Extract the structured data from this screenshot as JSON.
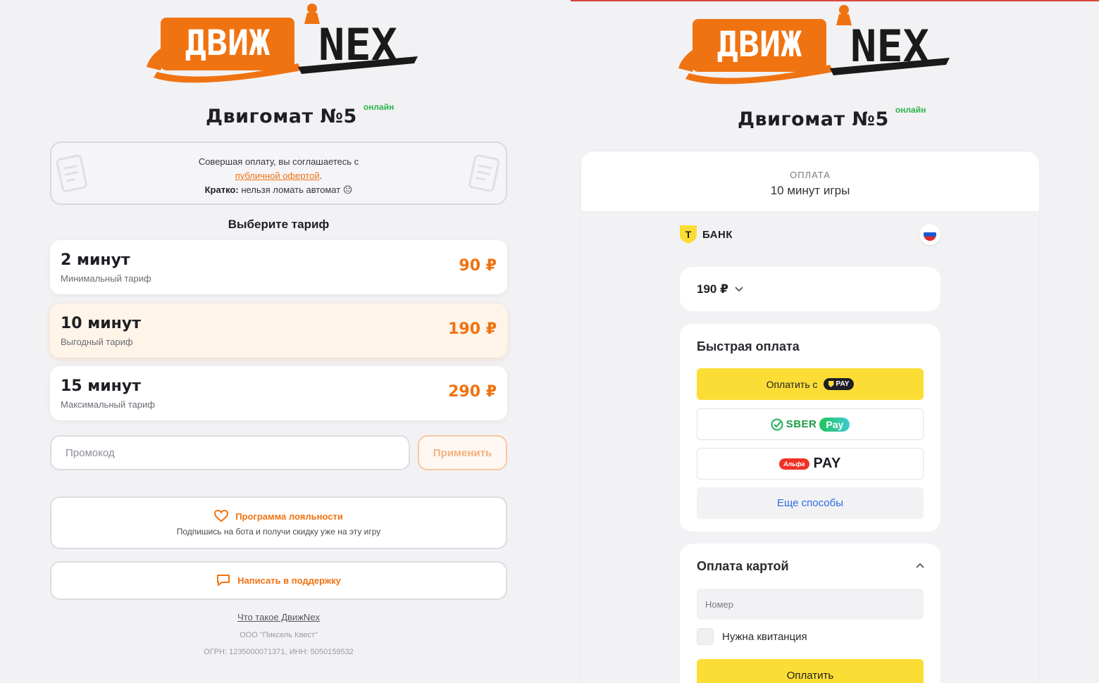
{
  "left": {
    "logo_text": "ДвижNex",
    "machine_title": "Двигомат №5",
    "status": "онлайн",
    "agreement": {
      "line1": "Совершая оплату, вы соглашаетесь с",
      "link": "публичной офертой",
      "link_suffix": ".",
      "short_label": "Кратко:",
      "short_text": "нельзя ломать автомат 😐"
    },
    "tariffs_title": "Выберите тариф",
    "tariffs": [
      {
        "name": "2 минут",
        "desc": "Минимальный тариф",
        "price": "90 ₽",
        "selected": false
      },
      {
        "name": "10 минут",
        "desc": "Выгодный тариф",
        "price": "190 ₽",
        "selected": true
      },
      {
        "name": "15 минут",
        "desc": "Максимальный тариф",
        "price": "290 ₽",
        "selected": false
      }
    ],
    "promo": {
      "placeholder": "Промокод",
      "apply_label": "Применить"
    },
    "loyalty": {
      "title": "Программа лояльности",
      "subtitle": "Подпишись на бота и получи скидку уже на эту игру"
    },
    "support": {
      "label": "Написать в поддержку"
    },
    "footer": {
      "about_link": "Что такое ДвижNex",
      "company": "ООО \"Пиксель Квест\"",
      "ids": "ОГРН: 1235000071371, ИНН: 5050159532"
    }
  },
  "right": {
    "logo_text": "ДвижNex",
    "machine_title": "Двигомат №5",
    "status": "онлайн",
    "payment": {
      "label": "ОПЛАТА",
      "description": "10 минут игры",
      "bank_name": "БАНК",
      "bank_letter": "Т",
      "amount": "190 ₽",
      "fast_title": "Быстрая оплата",
      "tpay_label": "Оплатить с",
      "tpay_badge": "PAY",
      "sber_word": "SBER",
      "sber_pay": "Pay",
      "alfa_badge": "Альфа",
      "alfa_word": "PAY",
      "more_label": "Еще способы",
      "card_title": "Оплата картой",
      "number_placeholder": "Номер",
      "receipt_label": "Нужна квитанция",
      "submit_label": "Оплатить"
    }
  },
  "colors": {
    "accent_orange": "#f07312",
    "online_green": "#2bb34a",
    "tbank_yellow": "#fcdd35",
    "link_blue": "#2d6be0"
  }
}
